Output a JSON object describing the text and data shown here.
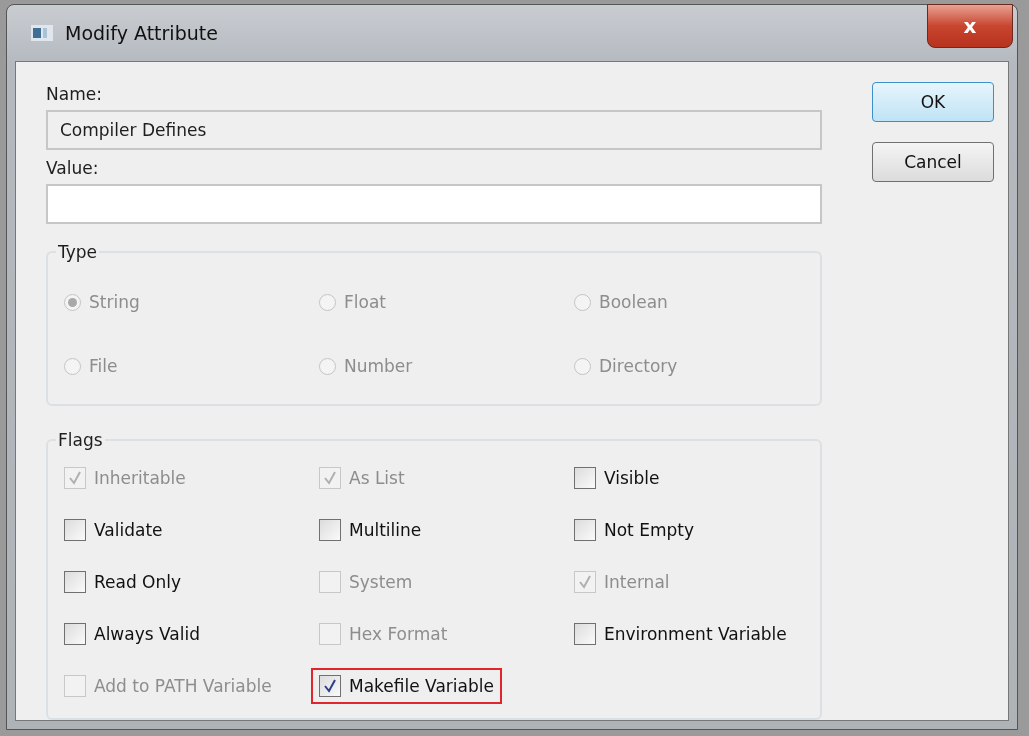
{
  "window": {
    "title": "Modify Attribute",
    "close_label": "x"
  },
  "name": {
    "label": "Name:",
    "value": "Compiler Defines",
    "disabled": true
  },
  "value": {
    "label": "Value:",
    "disabled": false
  },
  "buttons": [
    {
      "label": "OK",
      "default": true
    },
    {
      "label": "Cancel",
      "default": false
    }
  ],
  "type_group": {
    "title": "Type",
    "options": [
      {
        "label": "String",
        "selected": true,
        "disabled": true
      },
      {
        "label": "Float",
        "selected": false,
        "disabled": true
      },
      {
        "label": "Boolean",
        "selected": false,
        "disabled": true
      },
      {
        "label": "File",
        "selected": false,
        "disabled": true
      },
      {
        "label": "Number",
        "selected": false,
        "disabled": true
      },
      {
        "label": "Directory",
        "selected": false,
        "disabled": true
      }
    ]
  },
  "flags_group": {
    "title": "Flags",
    "items": [
      {
        "label": "Inheritable",
        "checked": true,
        "disabled": true,
        "highlighted": false
      },
      {
        "label": "As List",
        "checked": true,
        "disabled": true,
        "highlighted": false
      },
      {
        "label": "Visible",
        "checked": false,
        "disabled": false,
        "highlighted": false
      },
      {
        "label": "Validate",
        "checked": false,
        "disabled": false,
        "highlighted": false
      },
      {
        "label": "Multiline",
        "checked": false,
        "disabled": false,
        "highlighted": false
      },
      {
        "label": "Not Empty",
        "checked": false,
        "disabled": false,
        "highlighted": false
      },
      {
        "label": "Read Only",
        "checked": false,
        "disabled": false,
        "highlighted": false
      },
      {
        "label": "System",
        "checked": false,
        "disabled": true,
        "highlighted": false
      },
      {
        "label": "Internal",
        "checked": true,
        "disabled": true,
        "highlighted": false
      },
      {
        "label": "Always Valid",
        "checked": false,
        "disabled": false,
        "highlighted": false
      },
      {
        "label": "Hex Format",
        "checked": false,
        "disabled": true,
        "highlighted": false
      },
      {
        "label": "Environment Variable",
        "checked": false,
        "disabled": false,
        "highlighted": false
      },
      {
        "label": "Add to PATH Variable",
        "checked": false,
        "disabled": true,
        "highlighted": false
      },
      {
        "label": "Makefile Variable",
        "checked": true,
        "disabled": false,
        "highlighted": true
      }
    ]
  }
}
